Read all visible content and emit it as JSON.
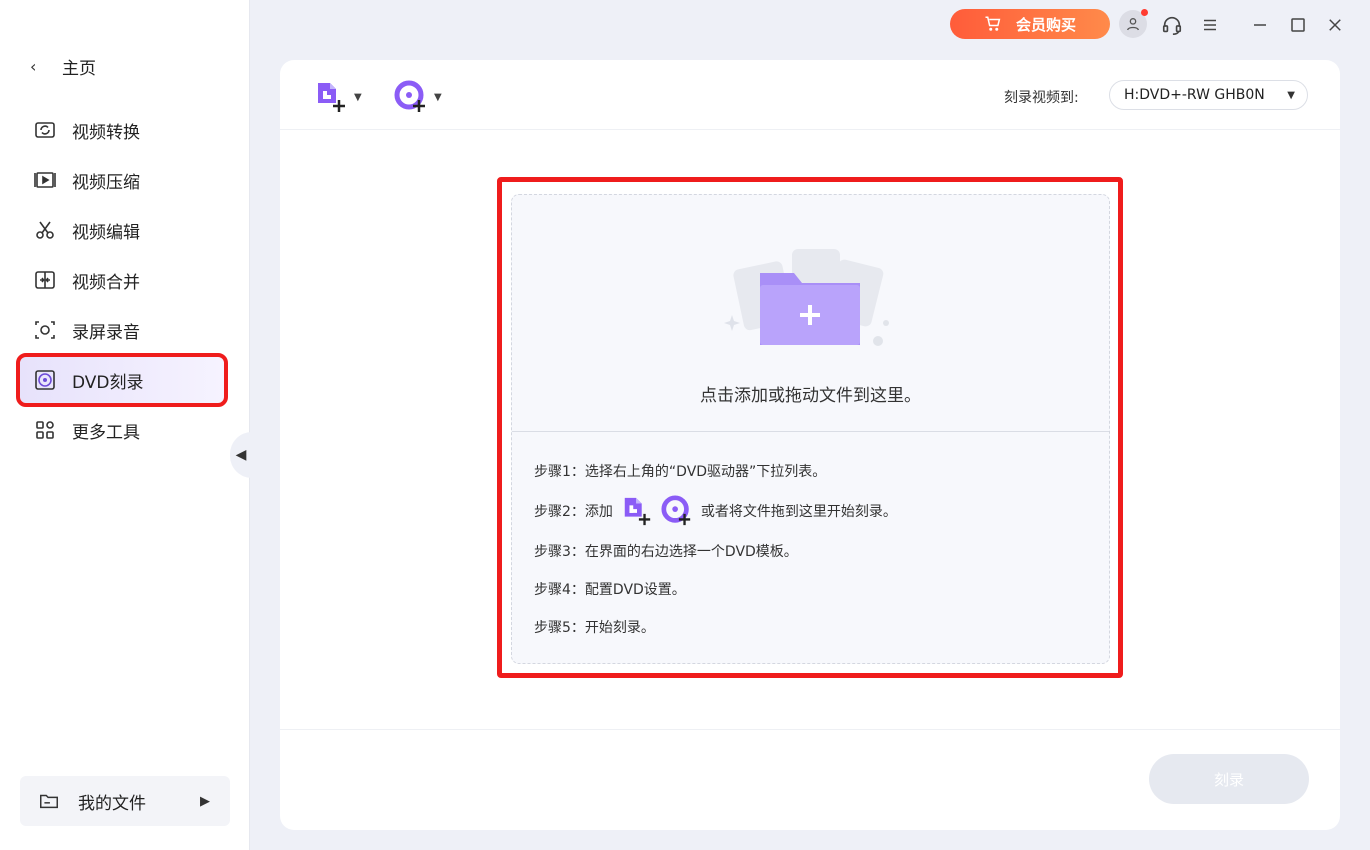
{
  "sidebar": {
    "back_label": "主页",
    "items": [
      {
        "label": "视频转换",
        "icon": "video-convert-icon"
      },
      {
        "label": "视频压缩",
        "icon": "video-compress-icon"
      },
      {
        "label": "视频编辑",
        "icon": "scissors-icon"
      },
      {
        "label": "视频合并",
        "icon": "video-merge-icon"
      },
      {
        "label": "录屏录音",
        "icon": "screen-record-icon"
      },
      {
        "label": "DVD刻录",
        "icon": "dvd-disc-icon",
        "active": true
      },
      {
        "label": "更多工具",
        "icon": "more-tools-icon"
      }
    ],
    "my_files_label": "我的文件"
  },
  "titlebar": {
    "vip_label": "会员购买",
    "accent": "#ff6a3d"
  },
  "toolbar": {
    "burn_to_label": "刻录视频到:",
    "drive_value": "H:DVD+-RW GHB0N"
  },
  "dropzone": {
    "hint": "点击添加或拖动文件到这里。",
    "step1": "步骤1：选择右上角的“DVD驱动器”下拉列表。",
    "step2_prefix": "步骤2：添加",
    "step2_suffix": "或者将文件拖到这里开始刻录。",
    "step3": "步骤3：在界面的右边选择一个DVD模板。",
    "step4": "步骤4：配置DVD设置。",
    "step5": "步骤5：开始刻录。"
  },
  "footer": {
    "burn_label": "刻录"
  },
  "colors": {
    "brand_purple": "#8b5cf6",
    "highlight_red": "#ef1c1c"
  }
}
